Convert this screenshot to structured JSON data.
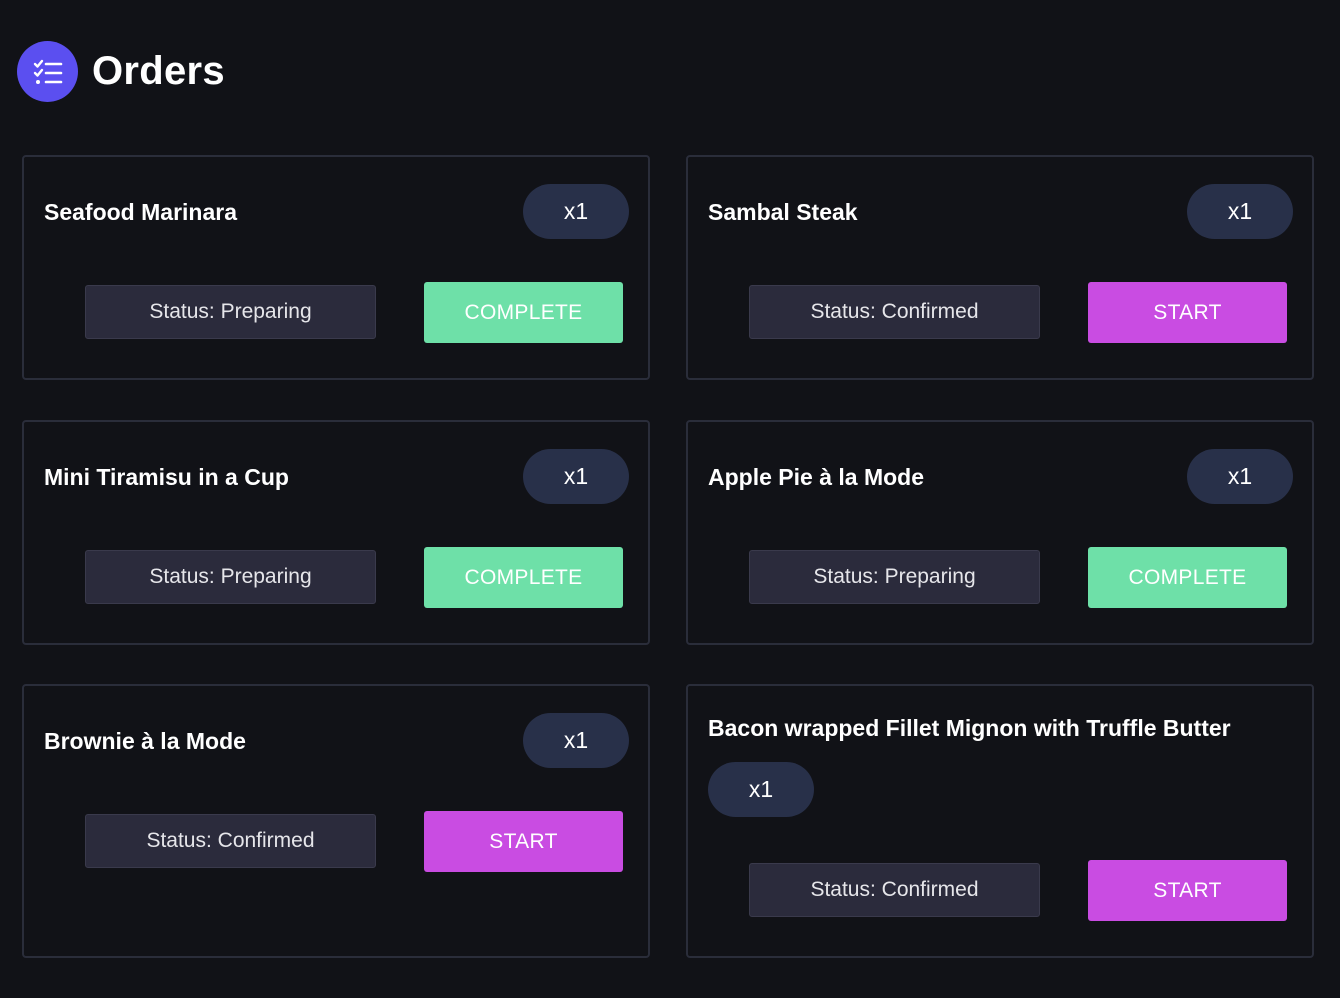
{
  "header": {
    "title": "Orders",
    "icon": "task-list-icon",
    "icon_color": "#5b4ff0"
  },
  "colors": {
    "background": "#111217",
    "complete": "#6ee0a8",
    "start": "#c94ce2",
    "quantity_badge": "#283049"
  },
  "orders": [
    {
      "name": "Seafood Marinara",
      "quantity": "x1",
      "status": "Status: Preparing",
      "action": "COMPLETE"
    },
    {
      "name": "Sambal Steak",
      "quantity": "x1",
      "status": "Status: Confirmed",
      "action": "START"
    },
    {
      "name": "Mini Tiramisu in a Cup",
      "quantity": "x1",
      "status": "Status: Preparing",
      "action": "COMPLETE"
    },
    {
      "name": "Apple Pie à la Mode",
      "quantity": "x1",
      "status": "Status: Preparing",
      "action": "COMPLETE"
    },
    {
      "name": "Brownie à la Mode",
      "quantity": "x1",
      "status": "Status: Confirmed",
      "action": "START"
    },
    {
      "name": "Bacon wrapped Fillet Mignon with Truffle Butter",
      "quantity": "x1",
      "status": "Status: Confirmed",
      "action": "START"
    }
  ]
}
